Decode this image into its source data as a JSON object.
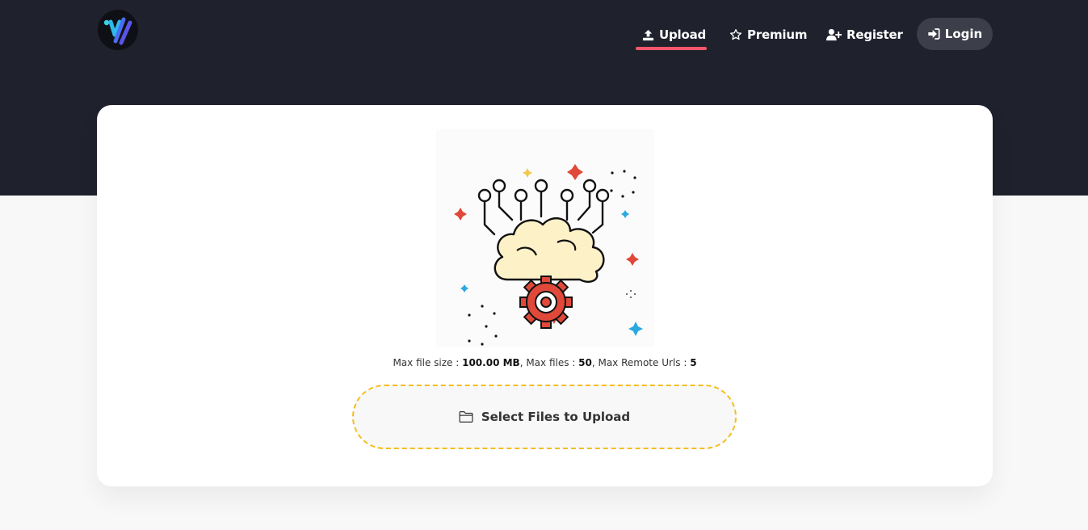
{
  "nav": {
    "upload_label": "Upload",
    "premium_label": "Premium",
    "register_label": "Register",
    "login_label": "Login"
  },
  "upload": {
    "limits_prefix": "Max file size : ",
    "max_file_size": "100.00 MB",
    "max_files_prefix": ", Max files : ",
    "max_files": "50",
    "max_urls_prefix": ", Max Remote Urls : ",
    "max_urls": "5",
    "select_label": "Select Files to Upload"
  },
  "colors": {
    "header_bg": "#1f212d",
    "accent_underline": "#f4566a",
    "dashed_border": "#f5bd1f",
    "login_bg": "#3c3e49"
  },
  "icons": {
    "upload": "upload-icon",
    "premium": "star-icon",
    "register": "user-plus-icon",
    "login": "sign-in-icon",
    "select": "folder-icon"
  }
}
